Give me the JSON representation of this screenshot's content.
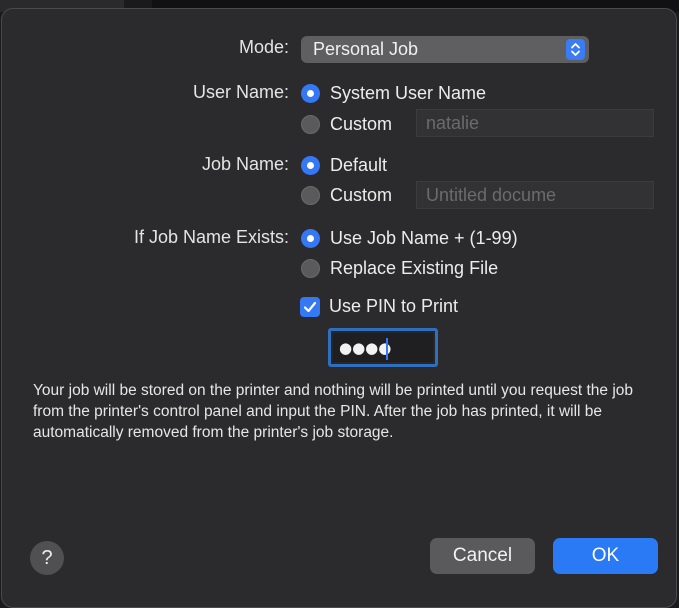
{
  "mode": {
    "label": "Mode:",
    "value": "Personal Job"
  },
  "user_name": {
    "label": "User Name:",
    "options": [
      {
        "label": "System User Name",
        "selected": true
      },
      {
        "label": "Custom",
        "selected": false
      }
    ],
    "custom_placeholder": "natalie"
  },
  "job_name": {
    "label": "Job Name:",
    "options": [
      {
        "label": "Default",
        "selected": true
      },
      {
        "label": "Custom",
        "selected": false
      }
    ],
    "custom_placeholder": "Untitled docume"
  },
  "job_exists": {
    "label": "If Job Name Exists:",
    "options": [
      {
        "label": "Use Job Name + (1-99)",
        "selected": true
      },
      {
        "label": "Replace Existing File",
        "selected": false
      }
    ]
  },
  "pin": {
    "checkbox_label": "Use PIN to Print",
    "checked": true,
    "masked_value": "●●●●"
  },
  "info_text": "Your job will be stored on the printer and nothing will be printed until you request the job from the printer's control panel and input the PIN. After the job has printed, it will be automatically removed from the printer's job storage.",
  "buttons": {
    "help": "?",
    "cancel": "Cancel",
    "ok": "OK"
  },
  "icons": {
    "popup": "chevron-up-down-icon",
    "checkbox": "checkmark-icon"
  },
  "colors": {
    "accent": "#3478f6",
    "sheet_bg": "#2b2b2d",
    "button_gray": "#5a5a5d"
  }
}
